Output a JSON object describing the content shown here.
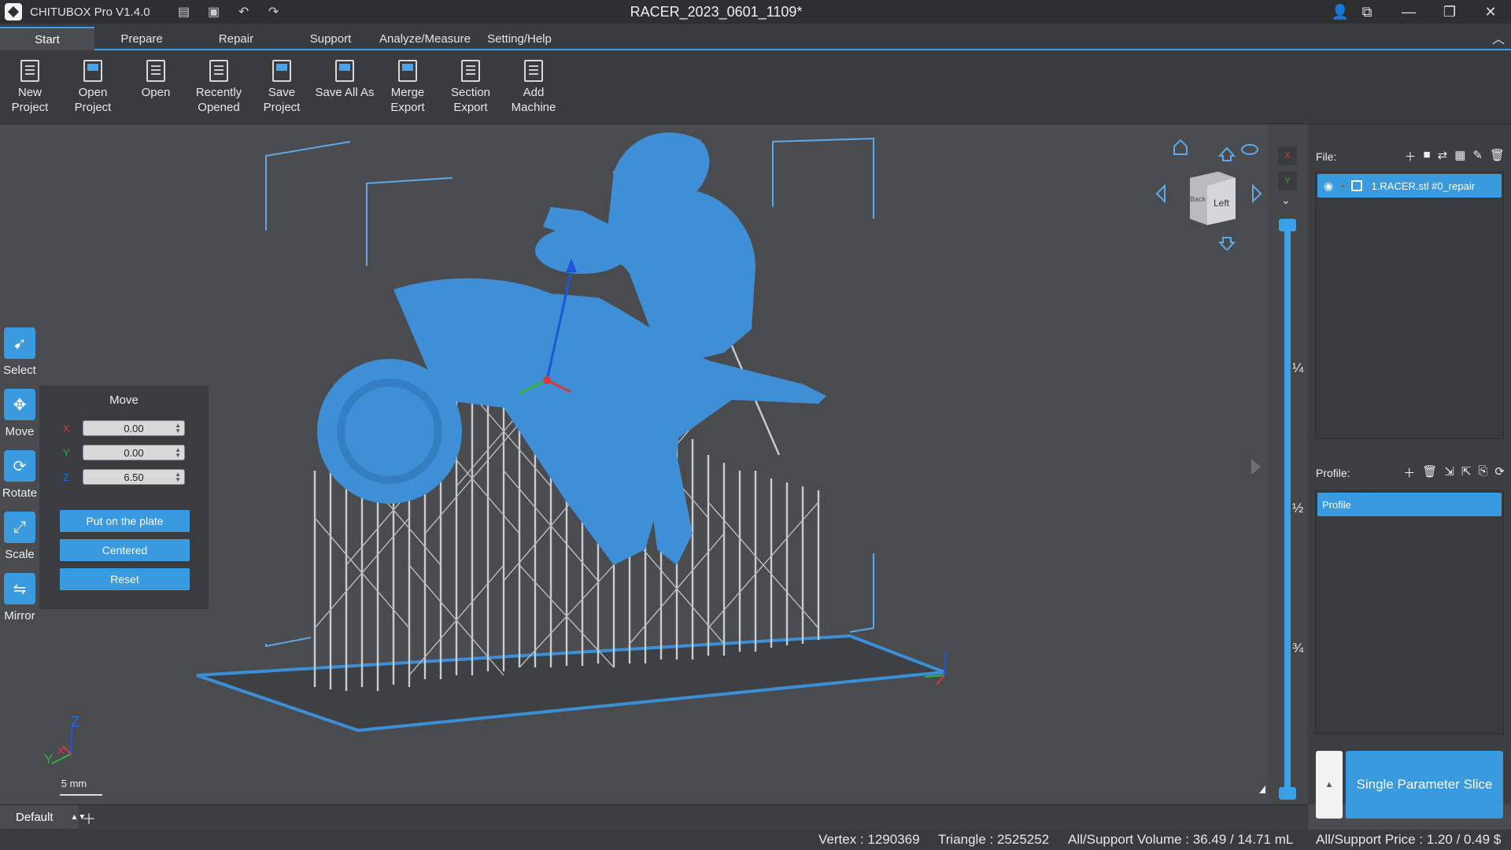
{
  "app": {
    "name": "CHITUBOX Pro V1.4.0",
    "document_title": "RACER_2023_0601_1109*"
  },
  "menu": {
    "tabs": [
      "Start",
      "Prepare",
      "Repair",
      "Support",
      "Analyze/Measure",
      "Setting/Help"
    ],
    "active": "Start"
  },
  "ribbon": {
    "items": [
      {
        "line1": "New Project",
        "line2": ""
      },
      {
        "line1": "Open",
        "line2": "Project"
      },
      {
        "line1": "Open",
        "line2": ""
      },
      {
        "line1": "Recently",
        "line2": "Opened"
      },
      {
        "line1": "Save",
        "line2": "Project"
      },
      {
        "line1": "Save All As",
        "line2": ""
      },
      {
        "line1": "Merge",
        "line2": "Export"
      },
      {
        "line1": "Section",
        "line2": "Export"
      },
      {
        "line1": "Add",
        "line2": "Machine"
      }
    ]
  },
  "tools": {
    "select": "Select",
    "move": "Move",
    "rotate": "Rotate",
    "scale": "Scale",
    "mirror": "Mirror"
  },
  "move_panel": {
    "title": "Move",
    "x_label": "X",
    "x_value": "0.00",
    "y_label": "Y",
    "y_value": "0.00",
    "z_label": "Z",
    "z_value": "6.50",
    "btn_plate": "Put on the plate",
    "btn_center": "Centered",
    "btn_reset": "Reset"
  },
  "nav_cube": {
    "face": "Left",
    "back_face": "Back"
  },
  "axes": {
    "z": "Z",
    "y": "Y",
    "x": "X"
  },
  "scale_bar": "5 mm",
  "layer_slider": {
    "q1": "¼",
    "half": "½",
    "q3": "¾",
    "x_tag": "X",
    "y_tag": "Y"
  },
  "right_panel": {
    "file_label": "File:",
    "file_name": "1.RACER.stl #0_repair",
    "profile_label": "Profile:",
    "profile_name": "Profile",
    "slice_button": "Single Parameter Slice"
  },
  "plates": {
    "current": "Default"
  },
  "status": {
    "vertex": "Vertex : 1290369",
    "triangle": "Triangle : 2525252",
    "volume": "All/Support Volume : 36.49 / 14.71 mL",
    "price": "All/Support Price : 1.20 / 0.49 $"
  },
  "colors": {
    "accent": "#3a9ae0",
    "model": "#3f8fd6",
    "support": "#c9cdcf"
  }
}
